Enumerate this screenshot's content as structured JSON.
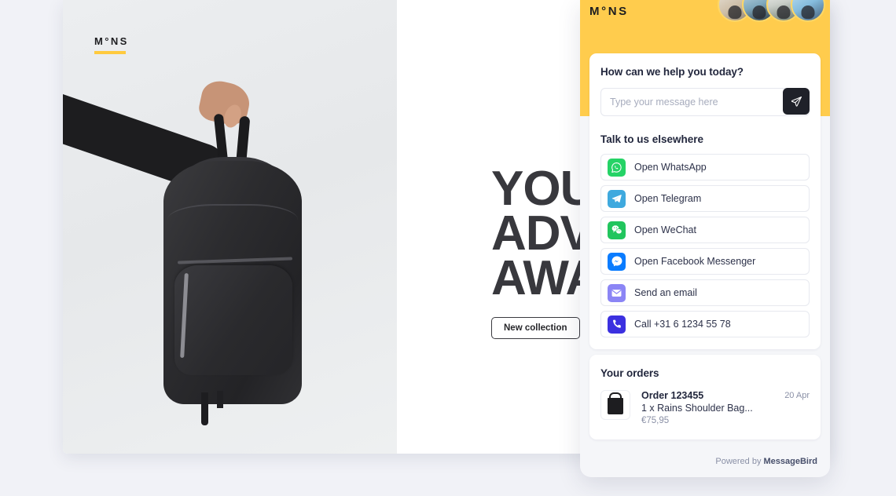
{
  "website": {
    "logo": "M°NS",
    "headline_lines": [
      "YOUR",
      "ADVE",
      "AWAI"
    ],
    "headline_full": "YOUR ADVENTURE AWAITS",
    "cta_label": "New collection",
    "hero_alt": "hand-holding-black-backpack"
  },
  "widget": {
    "brand": "M°NS",
    "header_color": "#ffcc4d",
    "agents_count": 4,
    "greeting": "How can we help you today?",
    "message_placeholder": "Type your message here",
    "message_value": "",
    "send_icon": "send-paper-plane-icon",
    "channels_title": "Talk to us elsewhere",
    "channels": [
      {
        "label": "Open WhatsApp",
        "icon": "whatsapp-icon",
        "color": "#25D366"
      },
      {
        "label": "Open Telegram",
        "icon": "telegram-icon",
        "color": "#3FA9DE"
      },
      {
        "label": "Open WeChat",
        "icon": "wechat-icon",
        "color": "#21C55D"
      },
      {
        "label": "Open Facebook Messenger",
        "icon": "messenger-icon",
        "color": "#0A7CFF"
      },
      {
        "label": "Send an email",
        "icon": "email-icon",
        "color": "#8B85F5"
      },
      {
        "label": "Call +31 6 1234 55 78",
        "icon": "phone-icon",
        "color": "#3B30E0"
      }
    ],
    "orders_title": "Your orders",
    "orders": [
      {
        "id": "Order 123455",
        "description": "1 x Rains Shoulder Bag...",
        "price": "€75,95",
        "date": "20 Apr",
        "thumb": "shoulder-bag-icon"
      }
    ],
    "footer_prefix": "Powered by ",
    "footer_brand": "MessageBird"
  }
}
